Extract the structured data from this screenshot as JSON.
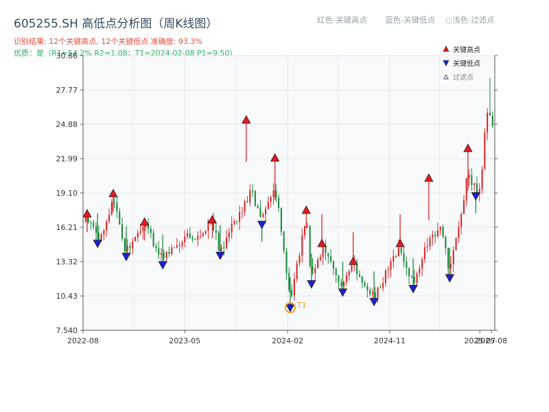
{
  "header": {
    "title": "605255.SH 高低点分析图（周K线图）",
    "result_line": "识别结果: 12个关键高点, 12个关键低点  准确度: 93.3%",
    "quality_line": "优质：是（R1=54.2%  R2=1.08；T1=2024-02-08 P1=9.50）",
    "legend_red": "红色-关键高点",
    "legend_blue": "蓝色-关键低点",
    "legend_hollow": "○浅色-过滤点"
  },
  "colors": {
    "up": "#d62728",
    "down": "#1a8a3a",
    "high_marker": "#e31a1c",
    "low_marker": "#1f1fd6",
    "t1": "#f39c12",
    "plot_bg": "#f8f9fb",
    "grid": "#e3e6ea"
  },
  "chart_data": {
    "type": "candlestick",
    "y_ticks": [
      "7.540",
      "10.43",
      "13.32",
      "16.21",
      "19.10",
      "21.99",
      "24.88",
      "27.77",
      "30.66"
    ],
    "ylim": [
      7.54,
      30.66
    ],
    "x_ticks": [
      {
        "label": "2022-08",
        "date": "2022-08-01"
      },
      {
        "label": "2023-05",
        "date": "2023-05-01"
      },
      {
        "label": "2024-02",
        "date": "2024-02-01"
      },
      {
        "label": "2024-11",
        "date": "2024-11-01"
      },
      {
        "label": "2025-07",
        "date": "2025-07-01"
      },
      {
        "label": "2025-08",
        "date": "2025-08-01"
      }
    ],
    "xlim": [
      "2022-08-01",
      "2025-08-10"
    ],
    "legend": {
      "position": "top-right",
      "entries": [
        "关键高点",
        "关键低点",
        "过滤点"
      ]
    },
    "key_highs": [
      {
        "date": "2022-08-12",
        "price": 17.3
      },
      {
        "date": "2022-10-21",
        "price": 19.0
      },
      {
        "date": "2023-01-13",
        "price": 16.6
      },
      {
        "date": "2023-07-14",
        "price": 16.8
      },
      {
        "date": "2023-10-13",
        "price": 25.2
      },
      {
        "date": "2023-12-29",
        "price": 22.0
      },
      {
        "date": "2024-03-22",
        "price": 17.6
      },
      {
        "date": "2024-05-03",
        "price": 14.8
      },
      {
        "date": "2024-07-26",
        "price": 13.3
      },
      {
        "date": "2024-11-29",
        "price": 14.8
      },
      {
        "date": "2025-02-14",
        "price": 20.3
      },
      {
        "date": "2025-05-30",
        "price": 22.8
      }
    ],
    "key_lows": [
      {
        "date": "2022-09-09",
        "price": 14.9
      },
      {
        "date": "2022-11-25",
        "price": 13.8
      },
      {
        "date": "2023-03-03",
        "price": 13.1
      },
      {
        "date": "2023-08-04",
        "price": 13.9
      },
      {
        "date": "2023-11-24",
        "price": 16.5
      },
      {
        "date": "2024-02-08",
        "price": 9.5
      },
      {
        "date": "2024-04-05",
        "price": 11.5
      },
      {
        "date": "2024-06-28",
        "price": 10.8
      },
      {
        "date": "2024-09-20",
        "price": 10.0
      },
      {
        "date": "2025-01-03",
        "price": 11.1
      },
      {
        "date": "2025-04-11",
        "price": 12.0
      },
      {
        "date": "2025-06-20",
        "price": 18.9
      }
    ],
    "t1": {
      "label": "T1",
      "date": "2024-02-08",
      "price": 9.5
    },
    "series_path": [
      [
        "2022-08-01",
        16.3
      ],
      [
        "2022-08-12",
        17.2
      ],
      [
        "2022-09-09",
        15.2
      ],
      [
        "2022-10-07",
        16.6
      ],
      [
        "2022-10-21",
        18.6
      ],
      [
        "2022-11-25",
        14.1
      ],
      [
        "2022-12-23",
        15.9
      ],
      [
        "2023-01-13",
        16.5
      ],
      [
        "2023-03-03",
        13.4
      ],
      [
        "2023-04-14",
        15.0
      ],
      [
        "2023-05-26",
        15.5
      ],
      [
        "2023-07-14",
        16.6
      ],
      [
        "2023-08-04",
        14.2
      ],
      [
        "2023-09-08",
        16.3
      ],
      [
        "2023-10-13",
        18.4
      ],
      [
        "2023-10-27",
        19.2
      ],
      [
        "2023-11-24",
        16.8
      ],
      [
        "2023-12-29",
        19.6
      ],
      [
        "2024-01-12",
        17.0
      ],
      [
        "2024-02-08",
        10.0
      ],
      [
        "2024-03-22",
        17.3
      ],
      [
        "2024-04-05",
        11.8
      ],
      [
        "2024-05-03",
        14.5
      ],
      [
        "2024-06-28",
        11.1
      ],
      [
        "2024-07-26",
        13.0
      ],
      [
        "2024-09-20",
        10.3
      ],
      [
        "2024-10-25",
        12.6
      ],
      [
        "2024-11-29",
        14.5
      ],
      [
        "2025-01-03",
        11.4
      ],
      [
        "2025-01-24",
        13.6
      ],
      [
        "2025-02-14",
        15.0
      ],
      [
        "2025-03-21",
        16.0
      ],
      [
        "2025-04-11",
        12.3
      ],
      [
        "2025-05-09",
        17.0
      ],
      [
        "2025-05-30",
        21.0
      ],
      [
        "2025-06-20",
        19.2
      ],
      [
        "2025-07-04",
        19.6
      ],
      [
        "2025-07-18",
        25.5
      ],
      [
        "2025-08-08",
        25.0
      ]
    ],
    "spikes": [
      [
        "2025-07-25",
        28.8
      ]
    ]
  }
}
